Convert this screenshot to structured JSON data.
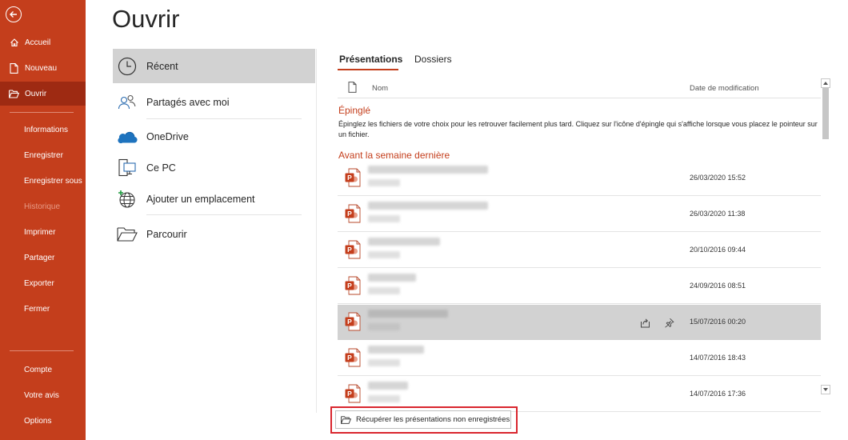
{
  "title": "Ouvrir",
  "sidebar": {
    "back_icon": "back-arrow-icon",
    "items": [
      {
        "label": "Accueil",
        "icon": "home-icon"
      },
      {
        "label": "Nouveau",
        "icon": "new-document-icon"
      },
      {
        "label": "Ouvrir",
        "icon": "folder-open-icon",
        "active": true
      },
      {
        "label": "Informations"
      },
      {
        "label": "Enregistrer"
      },
      {
        "label": "Enregistrer sous"
      },
      {
        "label": "Historique",
        "disabled": true
      },
      {
        "label": "Imprimer"
      },
      {
        "label": "Partager"
      },
      {
        "label": "Exporter"
      },
      {
        "label": "Fermer"
      },
      {
        "label": "Compte"
      },
      {
        "label": "Votre avis"
      },
      {
        "label": "Options"
      }
    ]
  },
  "locations": [
    {
      "label": "Récent",
      "icon": "clock-icon",
      "active": true
    },
    {
      "label": "Partagés avec moi",
      "icon": "people-icon"
    },
    {
      "label": "OneDrive",
      "icon": "onedrive-cloud-icon"
    },
    {
      "label": "Ce PC",
      "icon": "computer-icon"
    },
    {
      "label": "Ajouter un emplacement",
      "icon": "globe-add-icon"
    },
    {
      "label": "Parcourir",
      "icon": "folder-icon"
    }
  ],
  "tabs": [
    {
      "label": "Présentations",
      "active": true
    },
    {
      "label": "Dossiers"
    }
  ],
  "file_list": {
    "header_name": "Nom",
    "header_date": "Date de modification",
    "pinned_title": "Épinglé",
    "pinned_desc": "Épinglez les fichiers de votre choix pour les retrouver facilement plus tard. Cliquez sur l'icône d'épingle qui s'affiche lorsque vous placez le pointeur sur un fichier.",
    "section_title": "Avant la semaine dernière",
    "files": [
      {
        "date": "26/03/2020 15:52"
      },
      {
        "date": "26/03/2020 11:38"
      },
      {
        "date": "20/10/2016 09:44"
      },
      {
        "date": "24/09/2016 08:51"
      },
      {
        "date": "15/07/2016 00:20",
        "selected": true
      },
      {
        "date": "14/07/2016 18:43"
      },
      {
        "date": "14/07/2016 17:36"
      }
    ]
  },
  "recover_button": {
    "label": "Récupérer les présentations non enregistrées",
    "icon": "folder-open-icon"
  },
  "colors": {
    "accent": "#c43e1c",
    "sidebar_active": "#9e2a12",
    "highlight_box": "#d9262e",
    "selected_row": "#d2d2d2"
  }
}
